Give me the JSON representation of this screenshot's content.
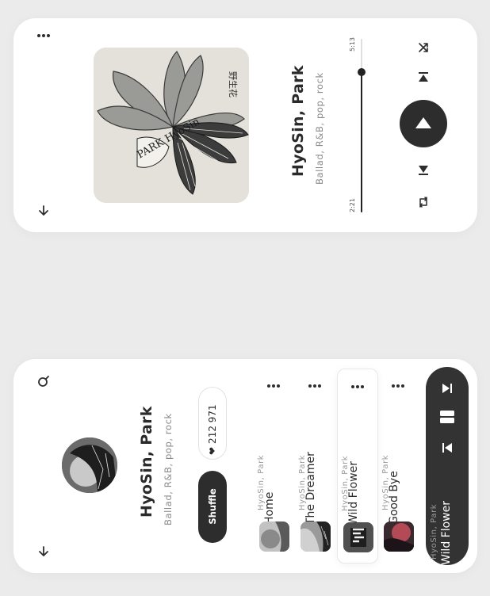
{
  "player": {
    "artist": "HyoSin, Park",
    "genres": "Ballad, R&B, pop, rock",
    "elapsed": "2:21",
    "duration": "5:13",
    "progress": 0.81,
    "album_art_text": "PARK HyoSin"
  },
  "album": {
    "artist": "HyoSin, Park",
    "genres": "Ballad, R&B, pop, rock",
    "likes": "212 971",
    "shuffle_label": "Shuffle",
    "tracks": [
      {
        "artist": "HyoSin, Park",
        "title": "Home"
      },
      {
        "artist": "HyoSin, Park",
        "title": "The Dreamer"
      },
      {
        "artist": "HyoSin, Park",
        "title": "Wild Flower"
      },
      {
        "artist": "HyoSin, Park",
        "title": "Good Bye"
      }
    ],
    "now_playing": {
      "artist": "HyoSin, Park",
      "title": "Wild Flower"
    }
  },
  "colors": {
    "accent": "#2d2d2d",
    "background": "#ebebeb",
    "card": "#ffffff"
  },
  "icons": [
    "more-icon",
    "arrow-down-icon",
    "shuffle-icon",
    "previous-icon",
    "play-icon",
    "next-icon",
    "repeat-icon",
    "search-icon",
    "heart-icon",
    "pause-icon"
  ]
}
